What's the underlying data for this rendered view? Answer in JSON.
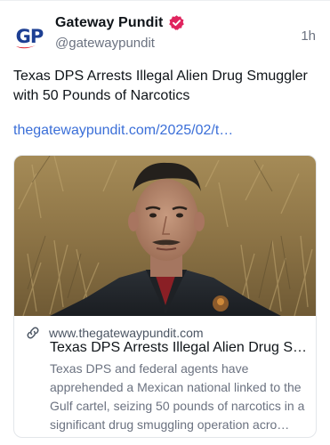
{
  "author": {
    "name": "Gateway Pundit",
    "handle": "@gatewaypundit",
    "avatar_initials": "GP",
    "verified": true
  },
  "time": "1h",
  "post": {
    "text": "Texas DPS Arrests Illegal Alien Drug Smuggler with 50 Pounds of Narcotics",
    "link": "thegatewaypundit.com/2025/02/t…"
  },
  "card": {
    "domain": "www.thegatewaypundit.com",
    "title": "Texas DPS Arrests Illegal Alien Drug S…",
    "description": "Texas DPS and federal agents have apprehended a Mexican national linked to the Gulf cartel, seizing 50 pounds of narcotics in a significant drug smuggling operation acro…",
    "image_icon": "photo-of-man-in-grass"
  },
  "colors": {
    "link": "#3b6fd8",
    "verified_badge": "#e0245e",
    "avatar_text": "#1d3f93",
    "avatar_swoosh": "#e11d2a"
  }
}
